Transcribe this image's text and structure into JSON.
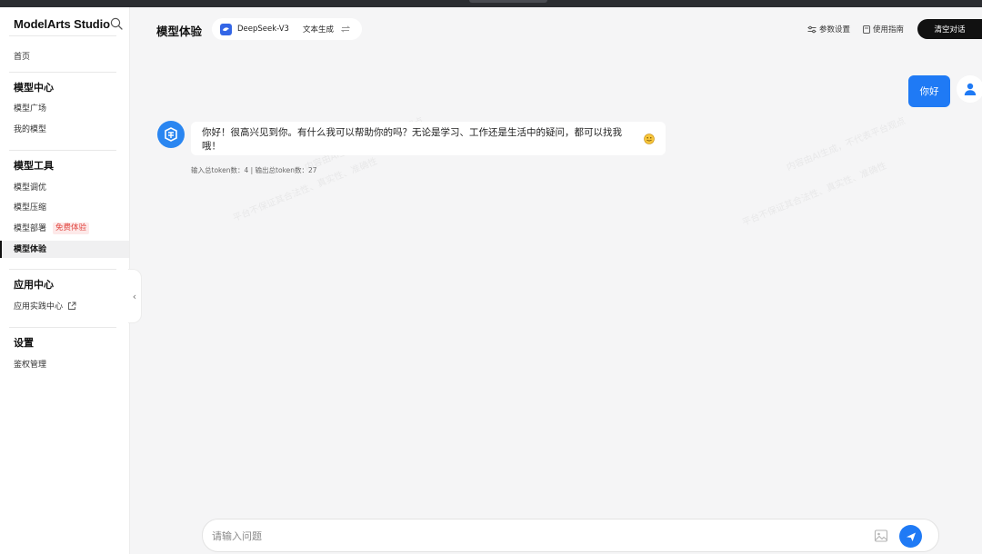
{
  "sidebar": {
    "brand": "ModelArts Studio",
    "home": "首页",
    "sections": {
      "model_center": {
        "title": "模型中心",
        "items": [
          "模型广场",
          "我的模型"
        ]
      },
      "model_tools": {
        "title": "模型工具",
        "items": [
          "模型调优",
          "模型压缩",
          "模型部署",
          "模型体验"
        ],
        "badge": "免费体验",
        "active": "模型体验"
      },
      "app_center": {
        "title": "应用中心",
        "items": [
          "应用实践中心"
        ]
      },
      "settings": {
        "title": "设置",
        "items": [
          "鉴权管理"
        ]
      }
    }
  },
  "header": {
    "title": "模型体验",
    "model_name": "DeepSeek-V3",
    "model_type": "文本生成",
    "params_label": "参数设置",
    "guide_label": "使用指南",
    "clear_label": "清空对话"
  },
  "chat": {
    "user_message": "你好",
    "bot_message": "你好！很高兴见到你。有什么我可以帮助你的吗？无论是学习、工作还是生活中的疑问，都可以找我哦！",
    "token_info": "输入总token数：4 | 输出总token数：27"
  },
  "input": {
    "placeholder": "请输入问题",
    "value": ""
  },
  "watermark": {
    "line1": "内容由AI生成，不代表平台观点",
    "line2": "平台不保证其合法性、真实性、准确性"
  },
  "colors": {
    "accent": "#1f7af5",
    "badge_text": "#e0453f",
    "badge_bg": "#fde9e9",
    "dark_button": "#111111"
  },
  "icons": {
    "brand_search": "search-icon",
    "params": "sliders-icon",
    "guide": "document-icon",
    "swap": "swap-icon",
    "collapse": "chevron-left-icon",
    "external": "external-link-icon",
    "image_upload": "image-icon",
    "send": "send-icon",
    "user": "user-icon",
    "bot": "bot-logo-icon",
    "emoji": "smile-emoji-icon"
  }
}
